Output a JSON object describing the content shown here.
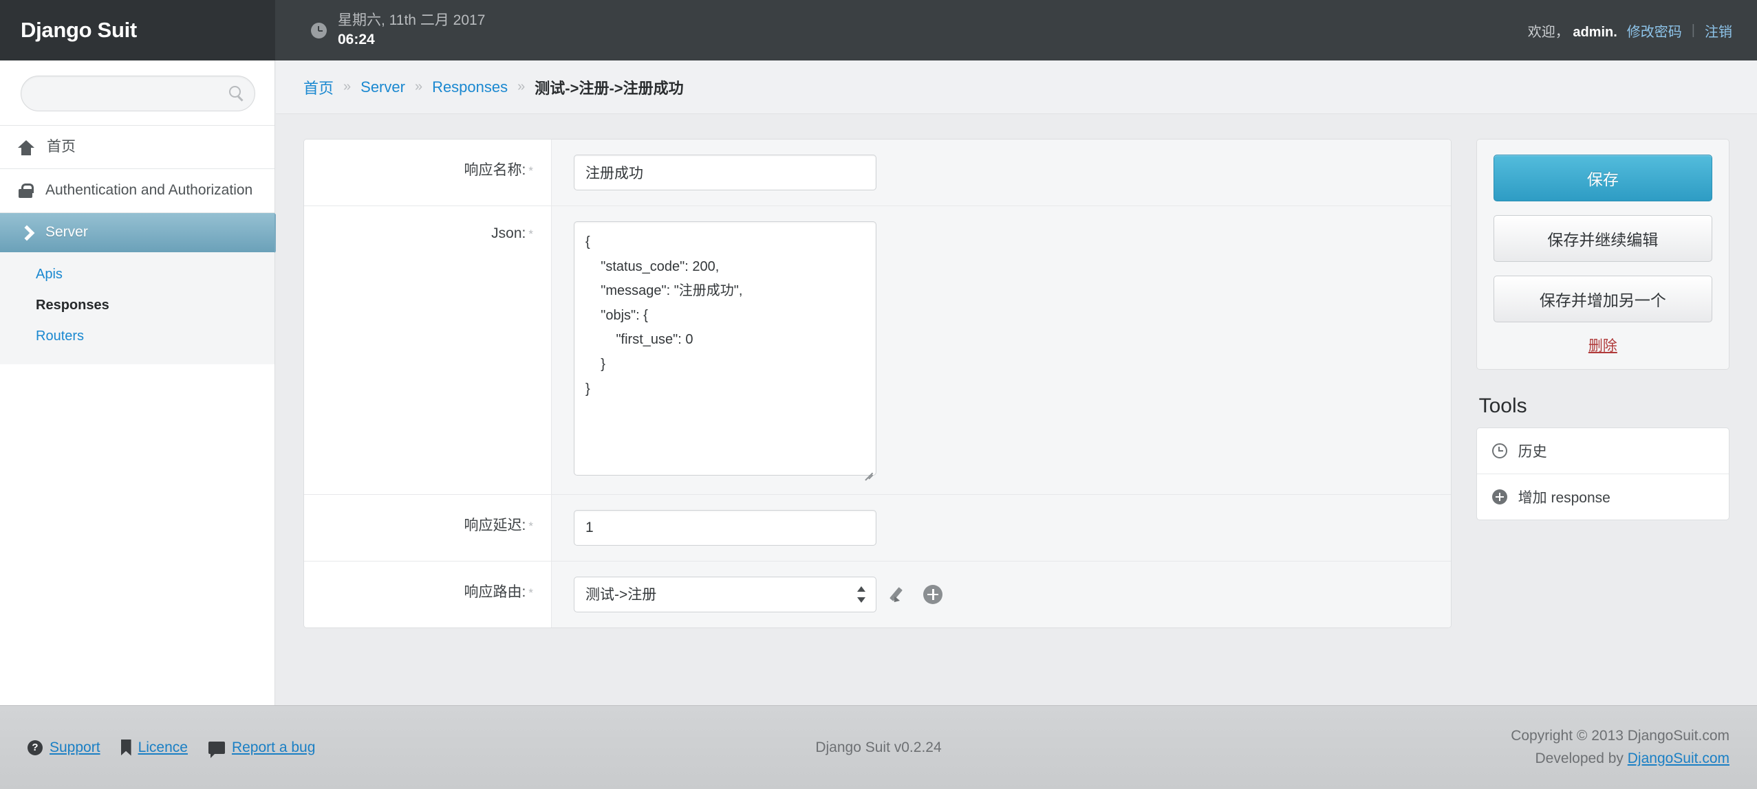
{
  "header": {
    "brand": "Django Suit",
    "date": "星期六, 11th 二月 2017",
    "time": "06:24",
    "welcome_prefix": "欢迎，",
    "username": "admin.",
    "change_password": "修改密码",
    "separator": "|",
    "logout": "注销"
  },
  "sidebar": {
    "search_placeholder": "",
    "search_value": "",
    "home_label": "首页",
    "auth_label": "Authentication and Authorization",
    "server_label": "Server",
    "submenu": [
      {
        "label": "Apis",
        "active": false
      },
      {
        "label": "Responses",
        "active": true
      },
      {
        "label": "Routers",
        "active": false
      }
    ]
  },
  "breadcrumb": {
    "home": "首页",
    "app": "Server",
    "model": "Responses",
    "current": "测试->注册->注册成功",
    "sep": "»"
  },
  "form": {
    "name_label": "响应名称:",
    "name_value": "注册成功",
    "json_label": "Json:",
    "json_value": "{\n    \"status_code\": 200,\n    \"message\": \"注册成功\",\n    \"objs\": {\n        \"first_use\": 0\n    }\n}",
    "delay_label": "响应延迟:",
    "delay_value": "1",
    "route_label": "响应路由:",
    "route_value": "测试->注册",
    "required_mark": "*"
  },
  "actions": {
    "save": "保存",
    "save_continue": "保存并继续编辑",
    "save_add_another": "保存并增加另一个",
    "delete": "删除"
  },
  "tools": {
    "title": "Tools",
    "items": [
      {
        "label": "历史"
      },
      {
        "label": "增加 response"
      }
    ]
  },
  "footer": {
    "support": "Support",
    "licence": "Licence",
    "report_bug": "Report a bug",
    "version": "Django Suit v0.2.24",
    "copyright": "Copyright © 2013 DjangoSuit.com",
    "developed_prefix": "Developed by ",
    "developed_link": "DjangoSuit.com",
    "help_glyph": "?"
  },
  "colors": {
    "header_bg": "#3b4043",
    "brand_bg": "#2f3336",
    "accent_blue": "#1a88d0",
    "save_button_top": "#53bcdc",
    "save_button_bottom": "#2e9cc4",
    "nav_active_top": "#95c0d2",
    "nav_active_bottom": "#6ba1b9",
    "delete_red": "#b03a3a"
  }
}
